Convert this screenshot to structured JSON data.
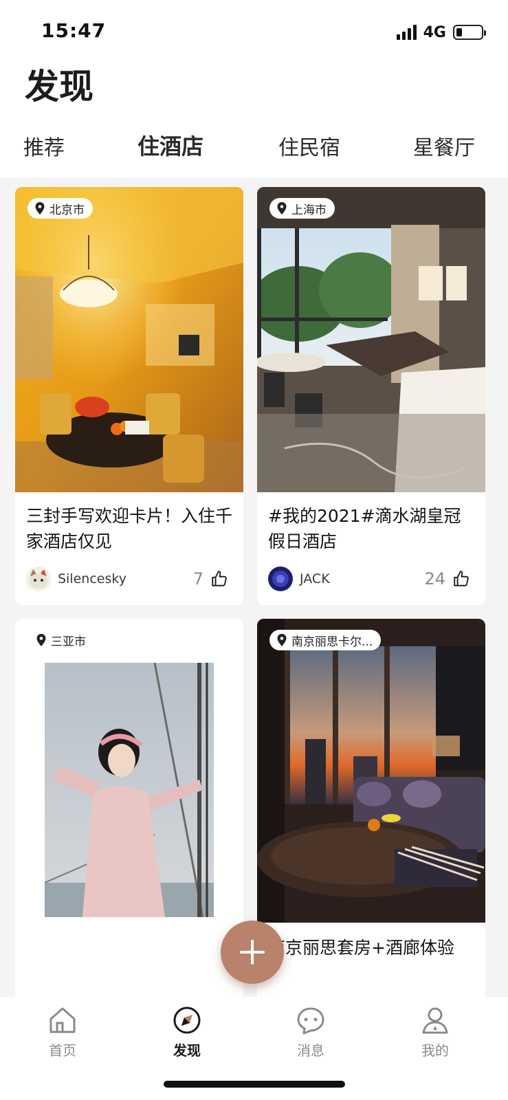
{
  "status_bar": {
    "time": "15:47",
    "network": "4G"
  },
  "header": {
    "title": "发现"
  },
  "tabs": [
    {
      "label": "推荐",
      "active": false
    },
    {
      "label": "住酒店",
      "active": true
    },
    {
      "label": "住民宿",
      "active": false
    },
    {
      "label": "星餐厅",
      "active": false
    }
  ],
  "cards": [
    {
      "location": "北京市",
      "title": "三封手写欢迎卡片！入住千家酒店仅见",
      "author": "Silencesky",
      "likes": "7"
    },
    {
      "location": "上海市",
      "title": "#我的2021#滴水湖皇冠假日酒店",
      "author": "JACK",
      "likes": "24"
    },
    {
      "location": "三亚市"
    },
    {
      "location": "南京丽思卡尔...",
      "title": "南京丽思套房+酒廊体验"
    }
  ],
  "bottom_nav": [
    {
      "label": "首页",
      "icon": "home-icon",
      "active": false
    },
    {
      "label": "发现",
      "icon": "compass-icon",
      "active": true
    },
    {
      "label": "消息",
      "icon": "chat-icon",
      "active": false
    },
    {
      "label": "我的",
      "icon": "profile-icon",
      "active": false
    }
  ],
  "colors": {
    "accent": "#b9826a",
    "background": "#f4f4f4",
    "card": "#ffffff"
  }
}
